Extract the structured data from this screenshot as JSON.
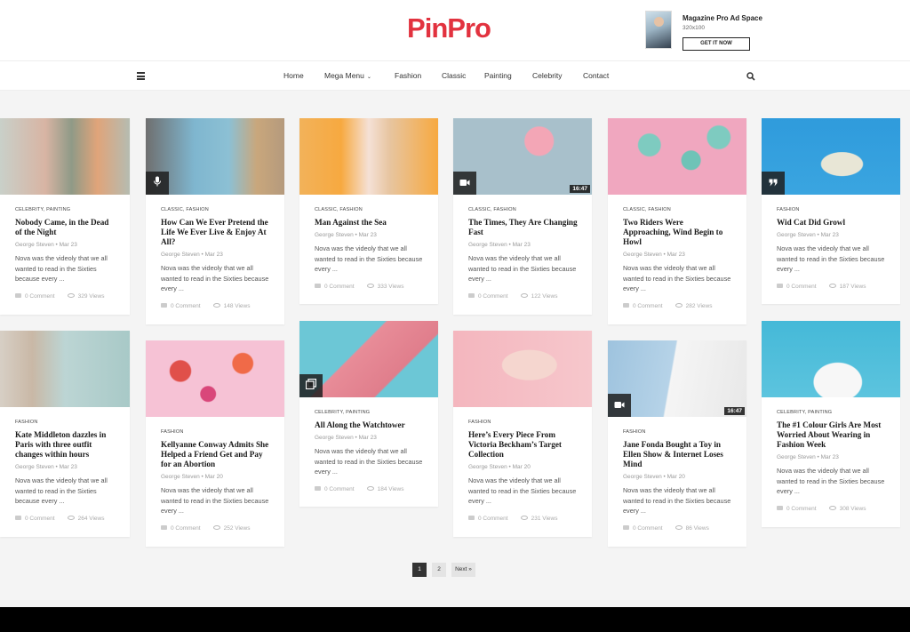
{
  "brand": {
    "logo": "PinPro",
    "logo_color": "#e2323f"
  },
  "ad": {
    "title": "Magazine Pro Ad Space",
    "size": "320x100",
    "button": "GET IT NOW"
  },
  "nav": {
    "items": [
      "Home",
      "Mega Menu",
      "Fashion",
      "Classic",
      "Painting",
      "Celebrity",
      "Contact"
    ],
    "mega_caret": "⌄"
  },
  "posts": [
    {
      "cats": "CELEBRITY, PAINTING",
      "title": "Nobody Came, in the Dead of the Night",
      "author": "George Steven",
      "date": "Mar 23",
      "excerpt": "Nova was the videoly that we all wanted to read in the Sixties because every ...",
      "comments": "0 Comment",
      "views": "329 Views",
      "media": "none",
      "icon": ""
    },
    {
      "cats": "CLASSIC, FASHION",
      "title": "How Can We Ever Pretend the Life We Ever Live & Enjoy At All?",
      "author": "George Steven",
      "date": "Mar 23",
      "excerpt": "Nova was the videoly that we all wanted to read in the Sixties because every ...",
      "comments": "0 Comment",
      "views": "148 Views",
      "media": "audio",
      "icon": "microphone-icon"
    },
    {
      "cats": "CLASSIC, FASHION",
      "title": "Man Against the Sea",
      "author": "George Steven",
      "date": "Mar 23",
      "excerpt": "Nova was the videoly that we all wanted to read in the Sixties because every ...",
      "comments": "0 Comment",
      "views": "333 Views",
      "media": "none",
      "icon": ""
    },
    {
      "cats": "CLASSIC, FASHION",
      "title": "The Times, They Are Changing Fast",
      "author": "George Steven",
      "date": "Mar 23",
      "excerpt": "Nova was the videoly that we all wanted to read in the Sixties because every ...",
      "comments": "0 Comment",
      "views": "122 Views",
      "media": "video",
      "icon": "video-camera-icon",
      "duration": "16:47"
    },
    {
      "cats": "CLASSIC, FASHION",
      "title": "Two Riders Were Approaching, Wind Begin to Howl",
      "author": "George Steven",
      "date": "Mar 23",
      "excerpt": "Nova was the videoly that we all wanted to read in the Sixties because every ...",
      "comments": "0 Comment",
      "views": "282 Views",
      "media": "none",
      "icon": ""
    },
    {
      "cats": "FASHION",
      "title": "Wid Cat Did Growl",
      "author": "George Steven",
      "date": "Mar 23",
      "excerpt": "Nova was the videoly that we all wanted to read in the Sixties because every ...",
      "comments": "0 Comment",
      "views": "187 Views",
      "media": "quote",
      "icon": "quote-icon"
    },
    {
      "cats": "FASHION",
      "title": "Kate Middleton dazzles in Paris with three outfit changes within hours",
      "author": "George Steven",
      "date": "Mar 23",
      "excerpt": "Nova was the videoly that we all wanted to read in the Sixties because every ...",
      "comments": "0 Comment",
      "views": "264 Views",
      "media": "none",
      "icon": ""
    },
    {
      "cats": "FASHION",
      "title": "Kellyanne Conway Admits She Helped a Friend Get and Pay for an Abortion",
      "author": "George Steven",
      "date": "Mar 20",
      "excerpt": "Nova was the videoly that we all wanted to read in the Sixties because every ...",
      "comments": "0 Comment",
      "views": "252 Views",
      "media": "none",
      "icon": ""
    },
    {
      "cats": "CELEBRITY, PAINTING",
      "title": "All Along the Watchtower",
      "author": "George Steven",
      "date": "Mar 23",
      "excerpt": "Nova was the videoly that we all wanted to read in the Sixties because every ...",
      "comments": "0 Comment",
      "views": "184 Views",
      "media": "gallery",
      "icon": "gallery-icon"
    },
    {
      "cats": "FASHION",
      "title": "Here’s Every Piece From Victoria Beckham’s Target Collection",
      "author": "George Steven",
      "date": "Mar 20",
      "excerpt": "Nova was the videoly that we all wanted to read in the Sixties because every ...",
      "comments": "0 Comment",
      "views": "231 Views",
      "media": "none",
      "icon": ""
    },
    {
      "cats": "FASHION",
      "title": "Jane Fonda Bought a Toy in Ellen Show & Internet Loses Mind",
      "author": "George Steven",
      "date": "Mar 20",
      "excerpt": "Nova was the videoly that we all wanted to read in the Sixties because every ...",
      "comments": "0 Comment",
      "views": "86 Views",
      "media": "video",
      "icon": "video-camera-icon",
      "duration": "16:47"
    },
    {
      "cats": "CELEBRITY, PAINTING",
      "title": "The #1 Colour Girls Are Most Worried About Wearing in Fashion Week",
      "author": "George Steven",
      "date": "Mar 23",
      "excerpt": "Nova was the videoly that we all wanted to read in the Sixties because every ...",
      "comments": "0 Comment",
      "views": "308 Views",
      "media": "none",
      "icon": ""
    }
  ],
  "pagination": {
    "page1": "1",
    "page2": "2",
    "next": "Next »",
    "current": "1"
  }
}
